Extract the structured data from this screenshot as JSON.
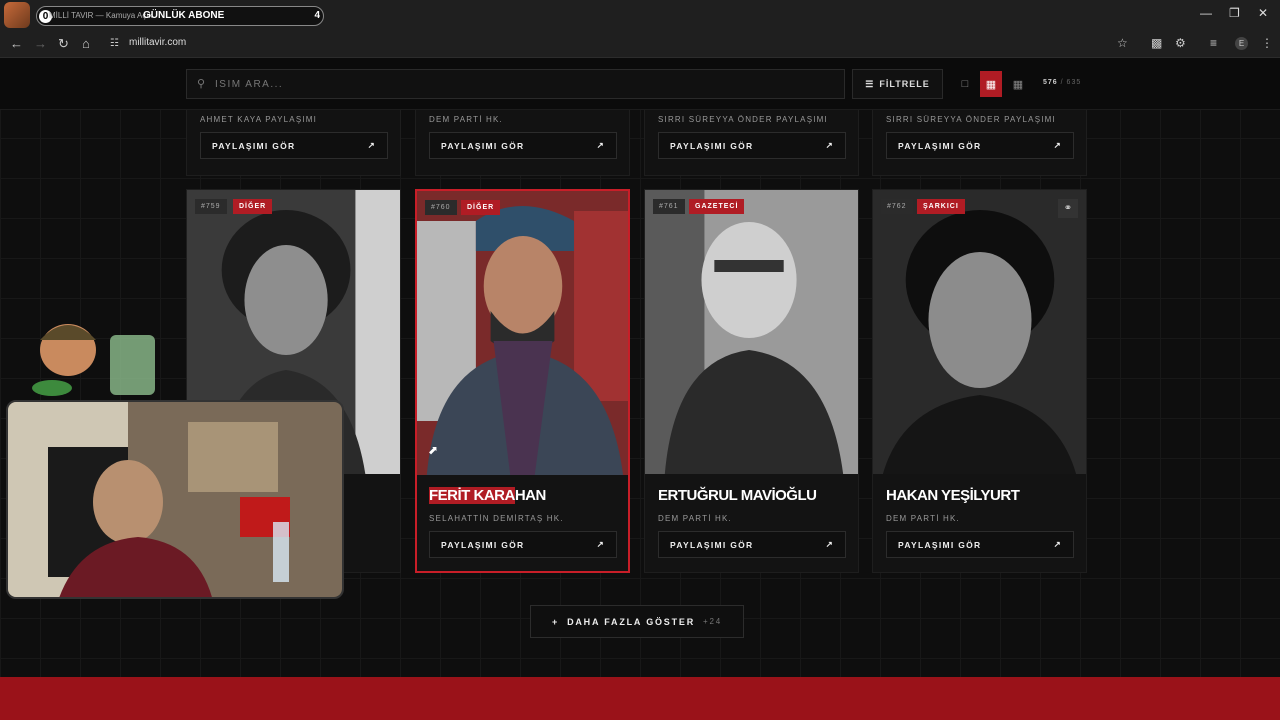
{
  "browser": {
    "tab_counter_left": "0",
    "tab_title": "MİLLİ TAVIR — Kamuya Açık",
    "tab_overlay_label": "GÜNLÜK ABONE",
    "tab_counter_right": "4",
    "url": "millitavir.com",
    "profile_initial": "E"
  },
  "toolbar": {
    "search_placeholder": "İSİM ARA...",
    "filter_label": "FİLTRELE",
    "count_current": "576",
    "count_separator": "/",
    "count_total": "635"
  },
  "top_cards": [
    {
      "party": "AHMET KAYA PAYLAŞIMI",
      "share_label": "PAYLAŞIMI GÖR"
    },
    {
      "party": "DEM PARTİ HK.",
      "share_label": "PAYLAŞIMI GÖR"
    },
    {
      "party": "SIRRI SÜREYYA ÖNDER PAYLAŞIMI",
      "share_label": "PAYLAŞIMI GÖR"
    },
    {
      "party": "SIRRI SÜREYYA ÖNDER PAYLAŞIMI",
      "share_label": "PAYLAŞIMI GÖR"
    }
  ],
  "cards": [
    {
      "id": "#759",
      "category": "DİĞER",
      "name": "",
      "party": "",
      "share_label": ""
    },
    {
      "id": "#760",
      "category": "DİĞER",
      "name_hl": "FERİT KARA",
      "name_rest": "HAN",
      "party": "SELAHATTİN DEMİRTAŞ HK.",
      "share_label": "PAYLAŞIMI GÖR"
    },
    {
      "id": "#761",
      "category": "GAZETECİ",
      "name": "ERTUĞRUL MAVİOĞLU",
      "party": "DEM PARTİ HK.",
      "share_label": "PAYLAŞIMI GÖR"
    },
    {
      "id": "#762",
      "category": "ŞARKICI",
      "name": "HAKAN YEŞİLYURT",
      "party": "DEM PARTİ HK.",
      "share_label": "PAYLAŞIMI GÖR"
    }
  ],
  "more_button": {
    "label": "DAHA FAZLA GÖSTER",
    "extra": "+24"
  },
  "icons": {
    "search": "search-icon",
    "filter": "sliders-icon",
    "arrow": "arrow-up-right-icon",
    "link": "link-icon",
    "plus": "plus-icon"
  },
  "colors": {
    "accent": "#b01c24",
    "background": "#0e0e0e"
  }
}
